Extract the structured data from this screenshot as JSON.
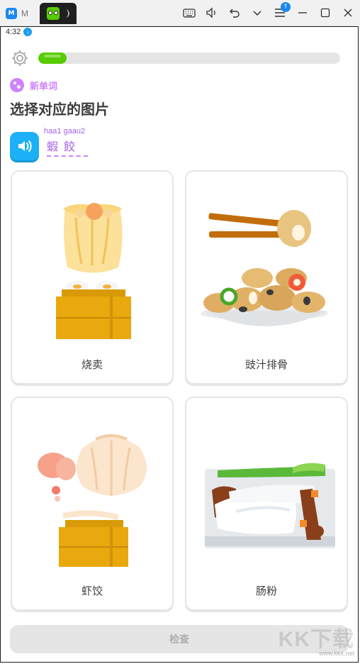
{
  "window": {
    "tab1_label": "M",
    "controls": [
      "keyboard-icon",
      "volume-icon",
      "undo-icon",
      "chevron-down-icon",
      "menu-icon",
      "minimize-icon",
      "maximize-icon",
      "close-icon"
    ],
    "update_badge": "↑"
  },
  "status": {
    "time": "4:32"
  },
  "progress": {
    "value_percent": 9.5,
    "color": "#58cc02"
  },
  "lesson": {
    "badge": "新单词",
    "title": "选择对应的图片",
    "romanization": "haa1 gaau2",
    "word": "蝦餃"
  },
  "choices": [
    {
      "label": "烧卖",
      "icon": "siu-mai-image"
    },
    {
      "label": "豉汁排骨",
      "icon": "spare-ribs-image"
    },
    {
      "label": "虾饺",
      "icon": "har-gow-image"
    },
    {
      "label": "肠粉",
      "icon": "rice-noodle-roll-image"
    }
  ],
  "check_button": {
    "label": "检查"
  },
  "watermark": {
    "brand": "KK下载",
    "url": "www.kkx.net"
  },
  "colors": {
    "accent_green": "#58cc02",
    "accent_blue": "#1cb0f6",
    "accent_purple": "#ce82ff"
  }
}
